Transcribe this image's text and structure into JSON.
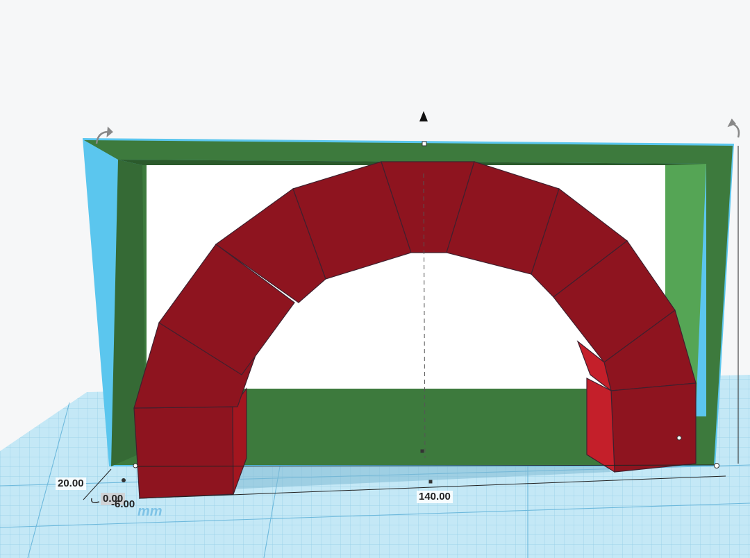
{
  "scene": {
    "grid_unit_label": "mm",
    "colors": {
      "background": "#f6f7f8",
      "workplane": "#c4e8f6",
      "grid_line": "#8ccbe6",
      "grid_major": "#59aed6",
      "frame_green": "#3d7a3d",
      "frame_green_light": "#55a555",
      "arch_red": "#8e141f",
      "arch_red_light": "#c41f2a",
      "selection_outline": "#5bc6ee"
    }
  },
  "dimensions": {
    "width": "140.00",
    "depth": "20.00",
    "elevation": "0.00",
    "offset": "-6.00"
  },
  "controls": {
    "lift_arrow_icon": "up-arrow-icon",
    "rotate_left_icon": "rotate-handle-icon",
    "rotate_right_icon": "rotate-handle-icon"
  }
}
